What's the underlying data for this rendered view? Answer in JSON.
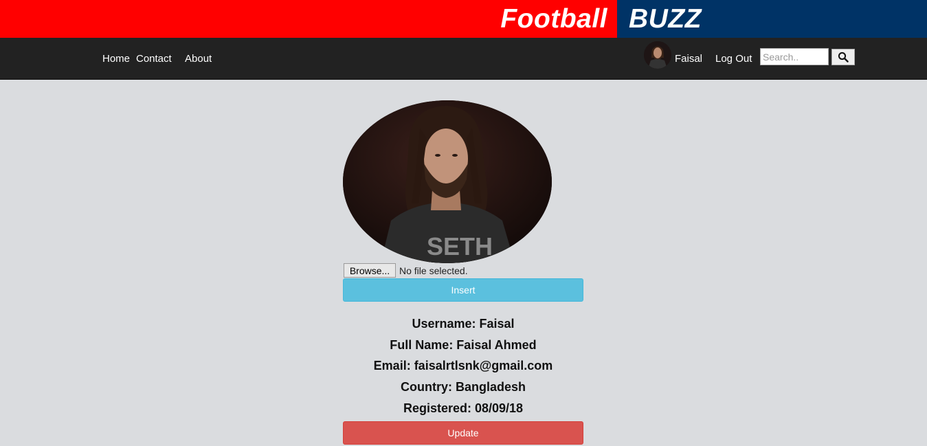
{
  "brand": {
    "left_text": "Football",
    "right_text": "BUZZ",
    "left_color": "#ff0000",
    "right_color": "#003366"
  },
  "nav": {
    "links": [
      {
        "label": "Home"
      },
      {
        "label": "Contact"
      },
      {
        "label": "About"
      }
    ],
    "user_name": "Faisal",
    "logout_label": "Log Out",
    "search_placeholder": "Search..",
    "search_icon": "magnifier-icon"
  },
  "profile": {
    "photo": "profile-photo (man with long hair, dark t-shirt)",
    "browse_label": "Browse...",
    "file_status": "No file selected.",
    "insert_label": "Insert",
    "info": [
      {
        "text": "Username: Faisal"
      },
      {
        "text": "Full Name: Faisal Ahmed"
      },
      {
        "text": "Email: faisalrtlsnk@gmail.com"
      },
      {
        "text": "Country: Bangladesh"
      },
      {
        "text": "Registered: 08/09/18"
      }
    ],
    "update_label": "Update"
  },
  "colors": {
    "insert_button": "#5bc0de",
    "update_button": "#d9534f",
    "navbar": "#222222",
    "page_bg": "#dadcdf"
  }
}
